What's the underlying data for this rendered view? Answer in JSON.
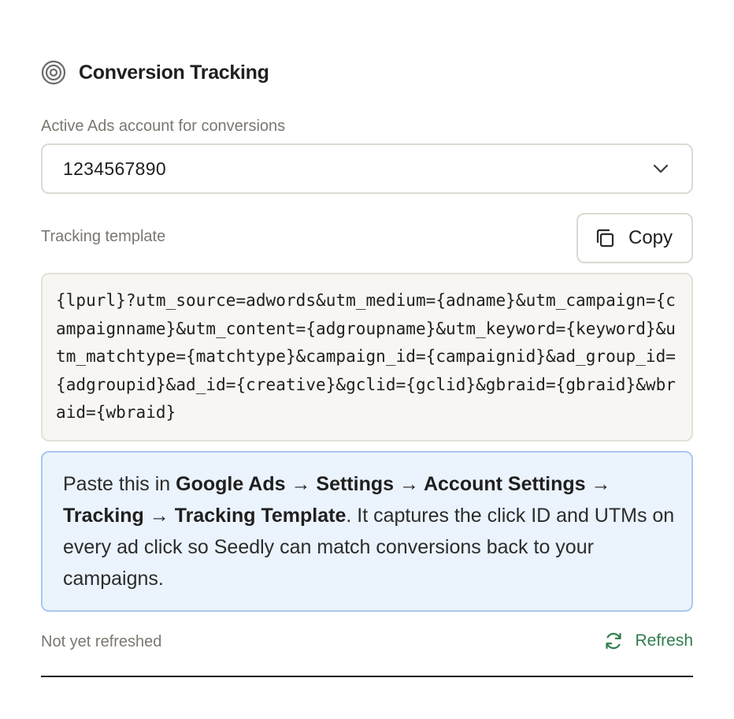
{
  "section": {
    "title": "Conversion Tracking",
    "icon": "target-icon"
  },
  "account": {
    "label": "Active Ads account for conversions",
    "selected_value": "1234567890",
    "icon": "chevron-down-icon"
  },
  "template": {
    "label": "Tracking template",
    "copy_label": "Copy",
    "copy_icon": "copy-icon",
    "value": "{lpurl}?utm_source=adwords&utm_medium={adname}&utm_campaign={campaignname}&utm_content={adgroupname}&utm_keyword={keyword}&utm_matchtype={matchtype}&campaign_id={campaignid}&ad_group_id={adgroupid}&ad_id={creative}&gclid={gclid}&gbraid={gbraid}&wbraid={wbraid}"
  },
  "info": {
    "prefix": "Paste this in ",
    "path": "Google Ads → Settings → Account Settings → Tracking → Tracking Template",
    "suffix": ". It captures the click ID and UTMs on every ad click so Seedly can match conversions back to your campaigns."
  },
  "footer": {
    "status": "Not yet refreshed",
    "refresh_label": "Refresh",
    "refresh_icon": "refresh-icon"
  },
  "colors": {
    "info_bg": "#ebf3fd",
    "info_border": "#a9c7f2",
    "refresh_green": "#2f7d4b",
    "muted_text": "#7b7770",
    "code_bg": "#f7f6f2"
  }
}
